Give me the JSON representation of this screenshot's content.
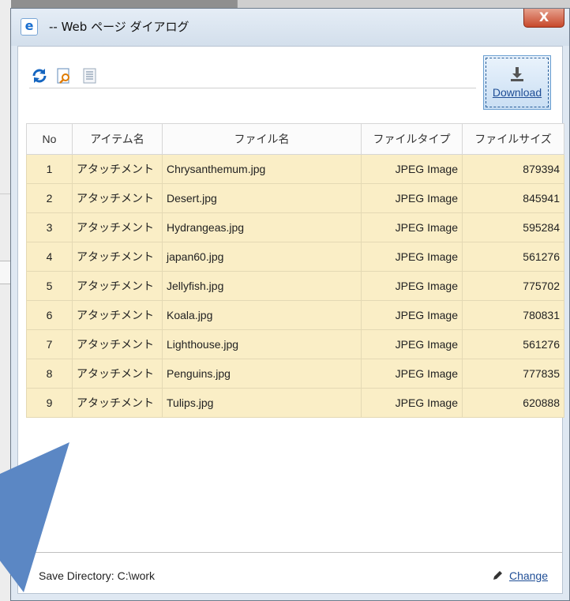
{
  "window": {
    "title": "-- Web ページ ダイアログ",
    "close_label": "X"
  },
  "toolbar": {
    "refresh_icon": "refresh-icon",
    "preview_icon": "preview-icon",
    "list_icon": "list-icon",
    "download_label": "Download"
  },
  "table": {
    "headers": {
      "no": "No",
      "item": "アイテム名",
      "file": "ファイル名",
      "type": "ファイルタイプ",
      "size": "ファイルサイズ"
    },
    "rows": [
      {
        "no": "1",
        "item": "アタッチメント",
        "file": "Chrysanthemum.jpg",
        "type": "JPEG Image",
        "size": "879394"
      },
      {
        "no": "2",
        "item": "アタッチメント",
        "file": "Desert.jpg",
        "type": "JPEG Image",
        "size": "845941"
      },
      {
        "no": "3",
        "item": "アタッチメント",
        "file": "Hydrangeas.jpg",
        "type": "JPEG Image",
        "size": "595284"
      },
      {
        "no": "4",
        "item": "アタッチメント",
        "file": "japan60.jpg",
        "type": "JPEG Image",
        "size": "561276"
      },
      {
        "no": "5",
        "item": "アタッチメント",
        "file": "Jellyfish.jpg",
        "type": "JPEG Image",
        "size": "775702"
      },
      {
        "no": "6",
        "item": "アタッチメント",
        "file": "Koala.jpg",
        "type": "JPEG Image",
        "size": "780831"
      },
      {
        "no": "7",
        "item": "アタッチメント",
        "file": "Lighthouse.jpg",
        "type": "JPEG Image",
        "size": "561276"
      },
      {
        "no": "8",
        "item": "アタッチメント",
        "file": "Penguins.jpg",
        "type": "JPEG Image",
        "size": "777835"
      },
      {
        "no": "9",
        "item": "アタッチメント",
        "file": "Tulips.jpg",
        "type": "JPEG Image",
        "size": "620888"
      }
    ]
  },
  "footer": {
    "save_directory": "Save Directory: C:\\work",
    "change_label": "Change"
  },
  "colors": {
    "row_highlight": "#faeec6",
    "link": "#1f4e96",
    "arrow": "#5b87c4"
  }
}
